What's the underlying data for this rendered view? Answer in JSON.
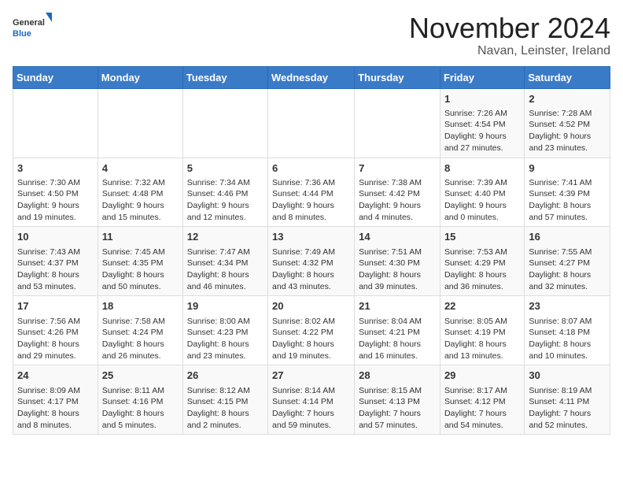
{
  "logo": {
    "general": "General",
    "blue": "Blue"
  },
  "title": "November 2024",
  "subtitle": "Navan, Leinster, Ireland",
  "headers": [
    "Sunday",
    "Monday",
    "Tuesday",
    "Wednesday",
    "Thursday",
    "Friday",
    "Saturday"
  ],
  "weeks": [
    [
      {
        "day": "",
        "info": ""
      },
      {
        "day": "",
        "info": ""
      },
      {
        "day": "",
        "info": ""
      },
      {
        "day": "",
        "info": ""
      },
      {
        "day": "",
        "info": ""
      },
      {
        "day": "1",
        "info": "Sunrise: 7:26 AM\nSunset: 4:54 PM\nDaylight: 9 hours and 27 minutes."
      },
      {
        "day": "2",
        "info": "Sunrise: 7:28 AM\nSunset: 4:52 PM\nDaylight: 9 hours and 23 minutes."
      }
    ],
    [
      {
        "day": "3",
        "info": "Sunrise: 7:30 AM\nSunset: 4:50 PM\nDaylight: 9 hours and 19 minutes."
      },
      {
        "day": "4",
        "info": "Sunrise: 7:32 AM\nSunset: 4:48 PM\nDaylight: 9 hours and 15 minutes."
      },
      {
        "day": "5",
        "info": "Sunrise: 7:34 AM\nSunset: 4:46 PM\nDaylight: 9 hours and 12 minutes."
      },
      {
        "day": "6",
        "info": "Sunrise: 7:36 AM\nSunset: 4:44 PM\nDaylight: 9 hours and 8 minutes."
      },
      {
        "day": "7",
        "info": "Sunrise: 7:38 AM\nSunset: 4:42 PM\nDaylight: 9 hours and 4 minutes."
      },
      {
        "day": "8",
        "info": "Sunrise: 7:39 AM\nSunset: 4:40 PM\nDaylight: 9 hours and 0 minutes."
      },
      {
        "day": "9",
        "info": "Sunrise: 7:41 AM\nSunset: 4:39 PM\nDaylight: 8 hours and 57 minutes."
      }
    ],
    [
      {
        "day": "10",
        "info": "Sunrise: 7:43 AM\nSunset: 4:37 PM\nDaylight: 8 hours and 53 minutes."
      },
      {
        "day": "11",
        "info": "Sunrise: 7:45 AM\nSunset: 4:35 PM\nDaylight: 8 hours and 50 minutes."
      },
      {
        "day": "12",
        "info": "Sunrise: 7:47 AM\nSunset: 4:34 PM\nDaylight: 8 hours and 46 minutes."
      },
      {
        "day": "13",
        "info": "Sunrise: 7:49 AM\nSunset: 4:32 PM\nDaylight: 8 hours and 43 minutes."
      },
      {
        "day": "14",
        "info": "Sunrise: 7:51 AM\nSunset: 4:30 PM\nDaylight: 8 hours and 39 minutes."
      },
      {
        "day": "15",
        "info": "Sunrise: 7:53 AM\nSunset: 4:29 PM\nDaylight: 8 hours and 36 minutes."
      },
      {
        "day": "16",
        "info": "Sunrise: 7:55 AM\nSunset: 4:27 PM\nDaylight: 8 hours and 32 minutes."
      }
    ],
    [
      {
        "day": "17",
        "info": "Sunrise: 7:56 AM\nSunset: 4:26 PM\nDaylight: 8 hours and 29 minutes."
      },
      {
        "day": "18",
        "info": "Sunrise: 7:58 AM\nSunset: 4:24 PM\nDaylight: 8 hours and 26 minutes."
      },
      {
        "day": "19",
        "info": "Sunrise: 8:00 AM\nSunset: 4:23 PM\nDaylight: 8 hours and 23 minutes."
      },
      {
        "day": "20",
        "info": "Sunrise: 8:02 AM\nSunset: 4:22 PM\nDaylight: 8 hours and 19 minutes."
      },
      {
        "day": "21",
        "info": "Sunrise: 8:04 AM\nSunset: 4:21 PM\nDaylight: 8 hours and 16 minutes."
      },
      {
        "day": "22",
        "info": "Sunrise: 8:05 AM\nSunset: 4:19 PM\nDaylight: 8 hours and 13 minutes."
      },
      {
        "day": "23",
        "info": "Sunrise: 8:07 AM\nSunset: 4:18 PM\nDaylight: 8 hours and 10 minutes."
      }
    ],
    [
      {
        "day": "24",
        "info": "Sunrise: 8:09 AM\nSunset: 4:17 PM\nDaylight: 8 hours and 8 minutes."
      },
      {
        "day": "25",
        "info": "Sunrise: 8:11 AM\nSunset: 4:16 PM\nDaylight: 8 hours and 5 minutes."
      },
      {
        "day": "26",
        "info": "Sunrise: 8:12 AM\nSunset: 4:15 PM\nDaylight: 8 hours and 2 minutes."
      },
      {
        "day": "27",
        "info": "Sunrise: 8:14 AM\nSunset: 4:14 PM\nDaylight: 7 hours and 59 minutes."
      },
      {
        "day": "28",
        "info": "Sunrise: 8:15 AM\nSunset: 4:13 PM\nDaylight: 7 hours and 57 minutes."
      },
      {
        "day": "29",
        "info": "Sunrise: 8:17 AM\nSunset: 4:12 PM\nDaylight: 7 hours and 54 minutes."
      },
      {
        "day": "30",
        "info": "Sunrise: 8:19 AM\nSunset: 4:11 PM\nDaylight: 7 hours and 52 minutes."
      }
    ]
  ]
}
